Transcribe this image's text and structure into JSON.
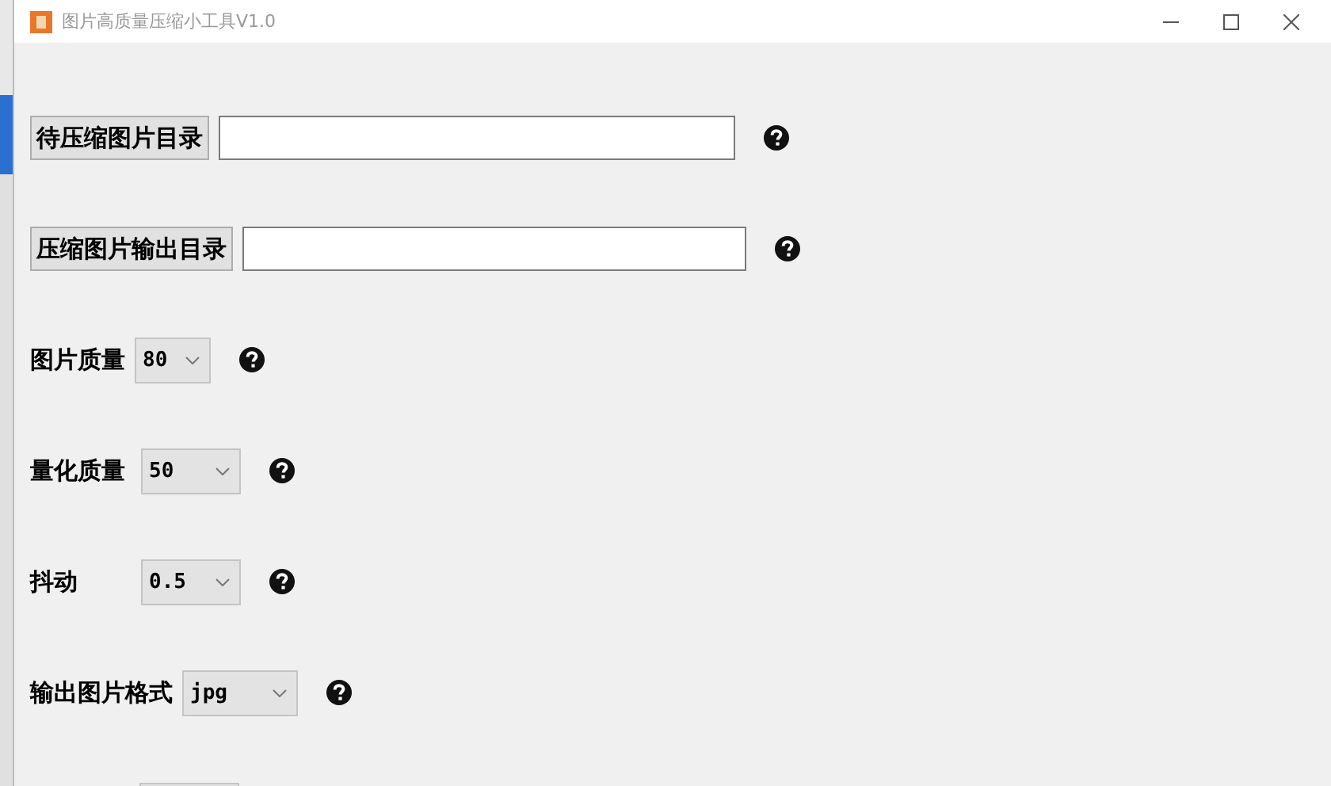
{
  "window": {
    "title": "图片高质量压缩小工具V1.0"
  },
  "rows": [
    {
      "kind": "path",
      "button": "待压缩图片目录"
    },
    {
      "kind": "path",
      "button": "压缩图片输出目录"
    },
    {
      "kind": "select",
      "label": "图片质量",
      "value": "80"
    },
    {
      "kind": "select",
      "label": "量化质量",
      "value": "50"
    },
    {
      "kind": "select",
      "label": "抖动",
      "value": "0.5"
    },
    {
      "kind": "select",
      "label": "输出图片格式",
      "value": "jpg"
    },
    {
      "kind": "partial"
    }
  ]
}
